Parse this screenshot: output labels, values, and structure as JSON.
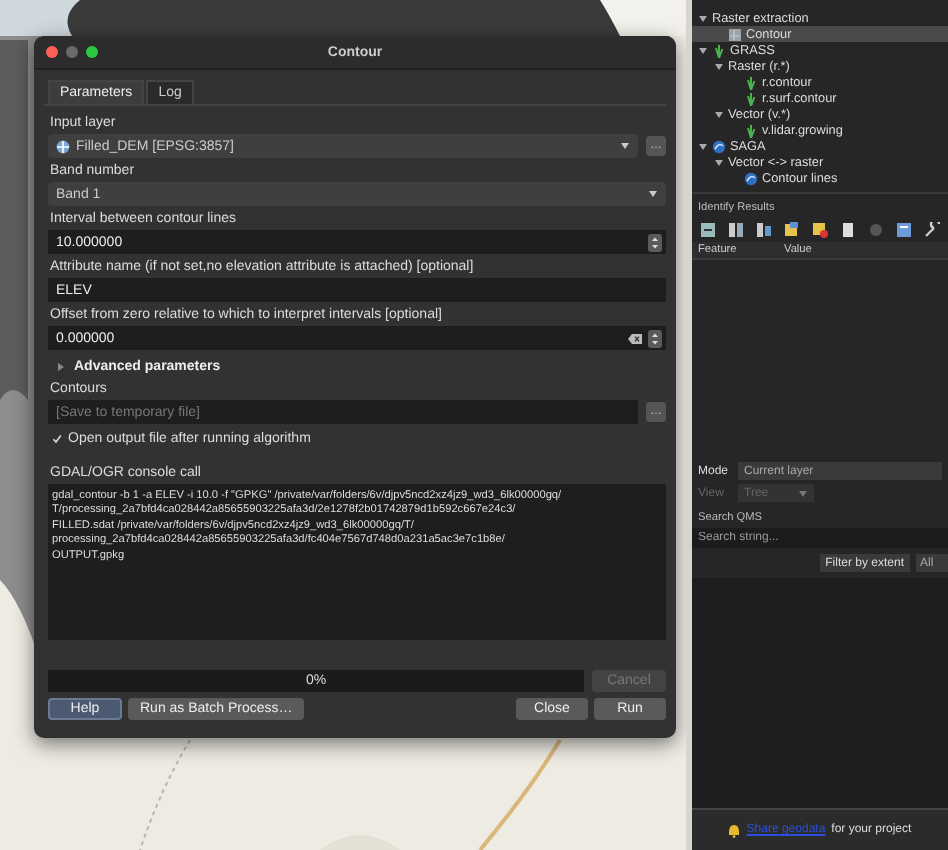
{
  "dialog": {
    "title": "Contour",
    "tabs": [
      {
        "label": "Parameters",
        "selected": true
      },
      {
        "label": "Log",
        "selected": false
      }
    ],
    "params": [
      {
        "kind": "layer",
        "label": "Input layer",
        "value": "Filled_DEM [EPSG:3857]",
        "button": "…"
      },
      {
        "kind": "combo",
        "label": "Band number",
        "value": "Band 1"
      },
      {
        "kind": "spin",
        "label": "Interval between contour lines",
        "value": "10.000000"
      },
      {
        "kind": "text",
        "label": "Attribute name (if not set,no elevation attribute is attached) [optional]",
        "value": "ELEV"
      },
      {
        "kind": "spin",
        "label": "Offset from zero relative to which to interpret intervals [optional]",
        "value": "0.000000",
        "clearable": true
      }
    ],
    "advanced": {
      "label": "Advanced parameters",
      "expanded": false
    },
    "output": {
      "label": "Contours",
      "placeholder": "[Save to temporary file]",
      "button": "…"
    },
    "open_output": {
      "label": "Open output file after running algorithm",
      "checked": true
    },
    "console": {
      "label": "GDAL/OGR console call",
      "lines": [
        "gdal_contour -b 1 -a ELEV -i 10.0 -f \"GPKG\" /private/var/folders/6v/djpv5ncd2xz4jz9_wd3_6lk00000gq/",
        "T/processing_2a7bfd4ca028442a85655903225afa3d/2e1278f2b01742879d1b592c667e24c3/",
        "FILLED.sdat /private/var/folders/6v/djpv5ncd2xz4jz9_wd3_6lk00000gq/T/",
        "processing_2a7bfd4ca028442a85655903225afa3d/fc404e7567d748d0a231a5ac3e7c1b8e/",
        "OUTPUT.gpkg"
      ]
    },
    "progress": {
      "level": 0,
      "reading": "0%"
    },
    "cancel": {
      "label": "Cancel",
      "disabled": true
    },
    "buttons": [
      {
        "label": "Help",
        "kind": "default"
      },
      {
        "label": "Run as Batch Process…",
        "kind": "plain"
      },
      {
        "label": "Close",
        "kind": "plain"
      },
      {
        "label": "Run",
        "kind": "plain"
      }
    ]
  },
  "toolbox": {
    "tree": [
      {
        "label": "Raster extraction",
        "expanded": true,
        "children": [
          {
            "label": "Contour",
            "kind": "gdal",
            "selected": true
          }
        ]
      },
      {
        "label": "GRASS",
        "kind": "grass",
        "expanded": true,
        "children": [
          {
            "label": "Raster (r.*)",
            "expanded": true,
            "children": [
              {
                "label": "r.contour",
                "kind": "grass",
                "selected": false
              },
              {
                "label": "r.surf.contour",
                "kind": "grass",
                "selected": false
              }
            ]
          },
          {
            "label": "Vector (v.*)",
            "expanded": true,
            "children": [
              {
                "label": "v.lidar.growing",
                "kind": "grass",
                "selected": false
              }
            ]
          }
        ]
      },
      {
        "label": "SAGA",
        "kind": "saga",
        "expanded": true,
        "children": [
          {
            "label": "Vector <-> raster",
            "expanded": true,
            "children": [
              {
                "label": "Contour lines",
                "kind": "saga",
                "selected": false
              }
            ]
          }
        ]
      }
    ]
  },
  "identify": {
    "title": "Identify Results",
    "columns": [
      "Feature",
      "Value"
    ],
    "mode": {
      "label": "Mode",
      "value": "Current layer"
    },
    "view": {
      "label": "View",
      "value": "Tree",
      "disabled": true
    }
  },
  "qms": {
    "title": "Search QMS",
    "placeholder": "Search string...",
    "filter_button": "Filter by extent",
    "filter_value": "All",
    "footer": {
      "link": "Share geodata",
      "text": "for your project"
    }
  }
}
